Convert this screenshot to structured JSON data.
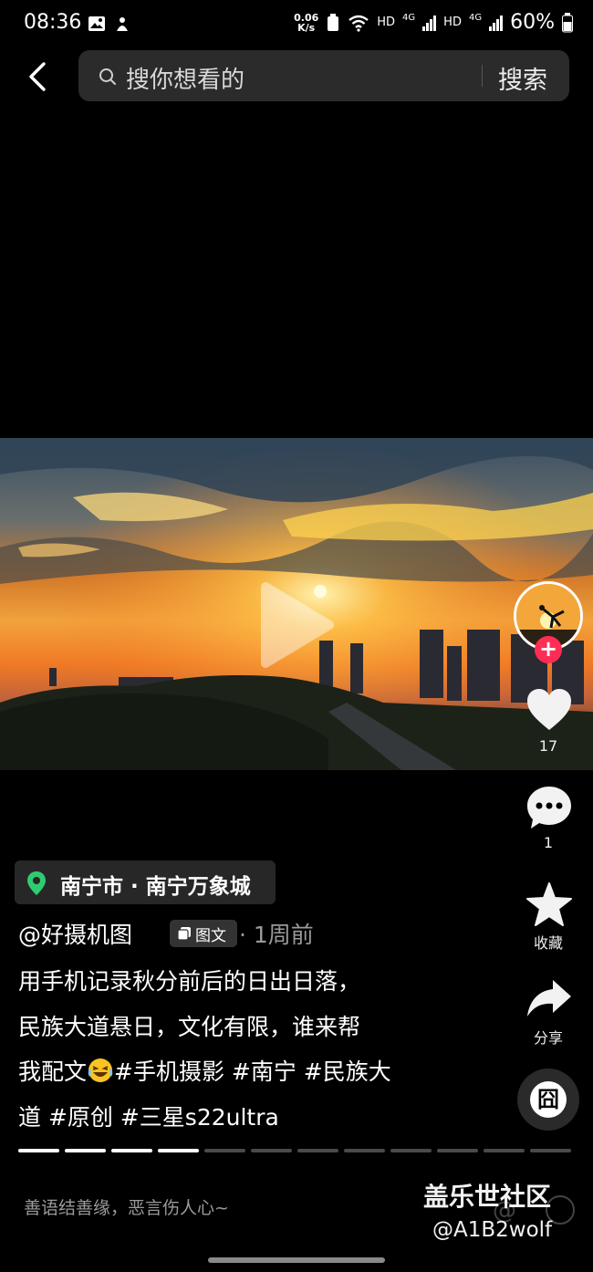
{
  "status_bar": {
    "time": "08:36",
    "net_speed_value": "0.06",
    "net_speed_unit": "K/s",
    "hd1": "HD",
    "net1": "4G",
    "hd2": "HD",
    "net2": "4G",
    "battery": "60%"
  },
  "search": {
    "placeholder": "搜你想看的",
    "button_label": "搜索"
  },
  "actions": {
    "like_count": "17",
    "comment_count": "1",
    "favorite_label": "收藏",
    "share_label": "分享",
    "react_glyph": "囧"
  },
  "location": {
    "text": "南宁市 · 南宁万象城"
  },
  "post": {
    "author": "@好摄机图",
    "type_badge": "图文",
    "time": "· 1周前",
    "caption_lines": [
      "用手机记录秋分前后的日出日落，",
      "民族大道悬日，文化有限，谁来帮",
      "我配文",
      "#手机摄影 #南宁 #民族大",
      "道 #原创 #三星s22ultra"
    ]
  },
  "pagination": {
    "total_pages": 12,
    "current_page": 4
  },
  "comment_input": {
    "placeholder": "善语结善缘，恶言伤人心~"
  },
  "watermark": {
    "title": "盖乐世社区",
    "user": "@A1B2wolf"
  },
  "colors": {
    "background": "#000000",
    "follow_badge": "#ff2d55",
    "location_pin": "#2ecc71",
    "chip_background": "#272727"
  }
}
